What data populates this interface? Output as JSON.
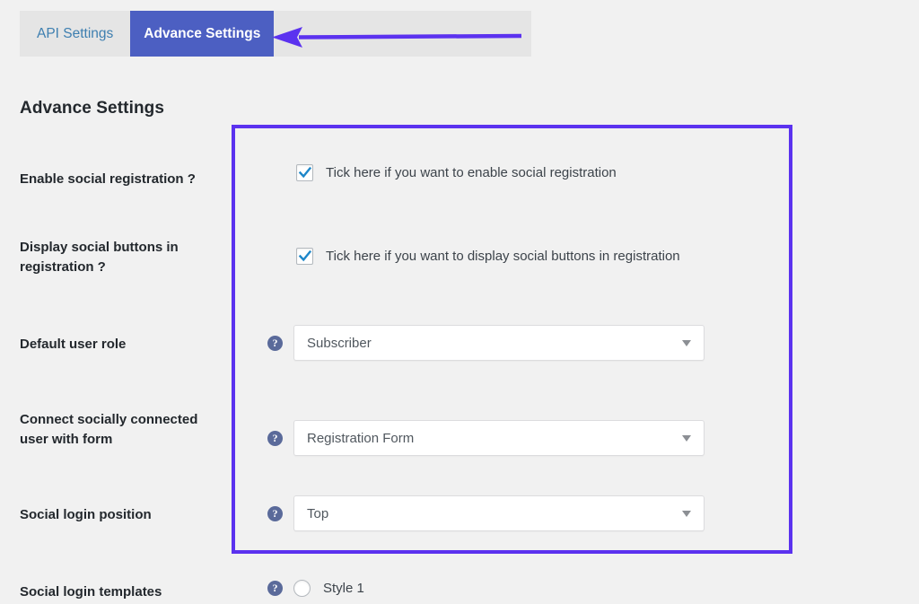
{
  "colors": {
    "accent_highlight": "#5b32ef",
    "tab_active_bg": "#4c5fc2",
    "tab_inactive_text": "#3e7fb0",
    "tabbar_bg": "#e5e5e5",
    "page_bg": "#f1f1f1",
    "checkmark": "#1e87c9",
    "help_icon_bg": "#5a6a9a"
  },
  "tabs": [
    {
      "label": "API Settings",
      "active": false,
      "name": "tab-api-settings"
    },
    {
      "label": "Advance Settings",
      "active": true,
      "name": "tab-advance-settings"
    }
  ],
  "annotation": {
    "arrow_icon": "arrow-left-icon",
    "points_to": "Advance Settings"
  },
  "page": {
    "title": "Advance Settings"
  },
  "settings": [
    {
      "label": "Enable social registration ?",
      "control": "checkbox",
      "checked": true,
      "checkbox_label": "Tick here if you want to enable social registration",
      "has_help": false
    },
    {
      "label": "Display social buttons in registration ?",
      "control": "checkbox",
      "checked": true,
      "checkbox_label": "Tick here if you want to display social buttons in registration",
      "has_help": false
    },
    {
      "label": "Default user role",
      "control": "select",
      "value": "Subscriber",
      "has_help": true,
      "help_icon": "help-icon"
    },
    {
      "label": "Connect socially connected user with form",
      "control": "select",
      "value": "Registration Form",
      "has_help": true,
      "help_icon": "help-icon"
    },
    {
      "label": "Social login position",
      "control": "select",
      "value": "Top",
      "has_help": true,
      "help_icon": "help-icon"
    },
    {
      "label": "Social login templates",
      "control": "radio",
      "checked": false,
      "radio_label": "Style 1",
      "has_help": true,
      "help_icon": "help-icon"
    }
  ],
  "help_glyph": "?"
}
